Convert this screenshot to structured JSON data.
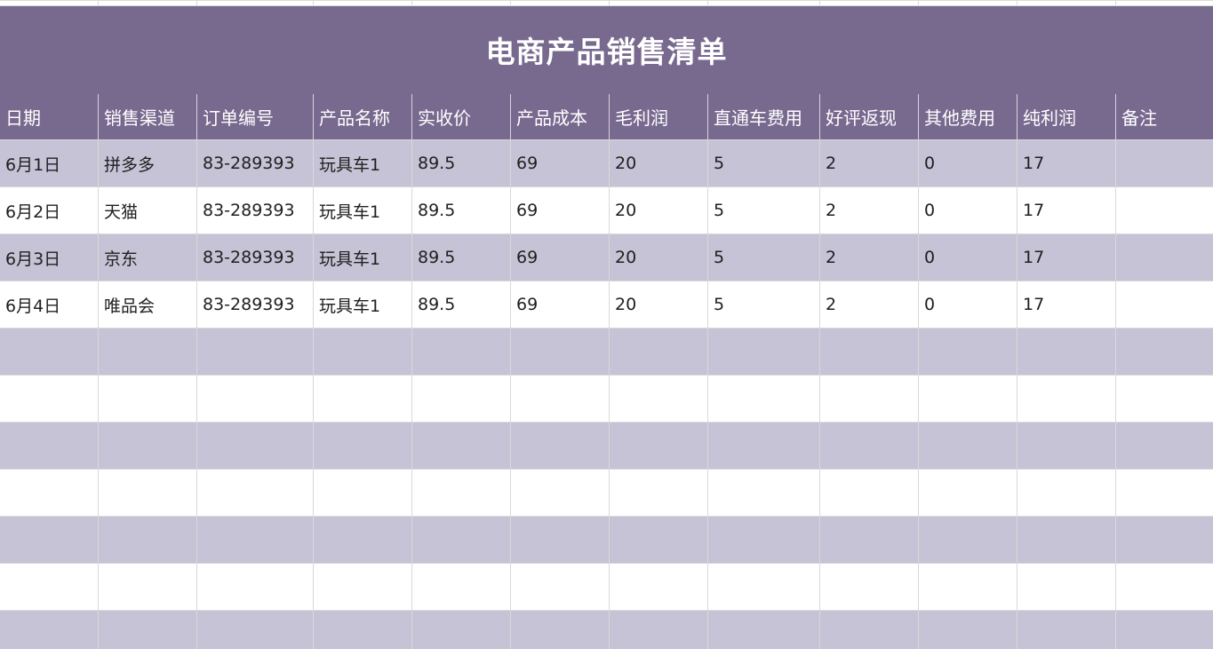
{
  "sheet": {
    "title": "电商产品销售清单",
    "columns": [
      "日期",
      "销售渠道",
      "订单编号",
      "产品名称",
      "实收价",
      "产品成本",
      "毛利润",
      "直通车费用",
      "好评返现",
      "其他费用",
      "纯利润",
      "备注"
    ],
    "rows": [
      [
        "6月1日",
        "拼多多",
        "83-289393",
        "玩具车1",
        "89.5",
        "69",
        "20",
        "5",
        "2",
        "0",
        "17",
        ""
      ],
      [
        "6月2日",
        "天猫",
        "83-289393",
        "玩具车1",
        "89.5",
        "69",
        "20",
        "5",
        "2",
        "0",
        "17",
        ""
      ],
      [
        "6月3日",
        "京东",
        "83-289393",
        "玩具车1",
        "89.5",
        "69",
        "20",
        "5",
        "2",
        "0",
        "17",
        ""
      ],
      [
        "6月4日",
        "唯品会",
        "83-289393",
        "玩具车1",
        "89.5",
        "69",
        "20",
        "5",
        "2",
        "0",
        "17",
        ""
      ]
    ],
    "colors": {
      "header_bg": "#786a8f",
      "band_bg": "#c5c3d5",
      "plain_bg": "#ffffff",
      "selection_border": "#4a90d9"
    }
  }
}
